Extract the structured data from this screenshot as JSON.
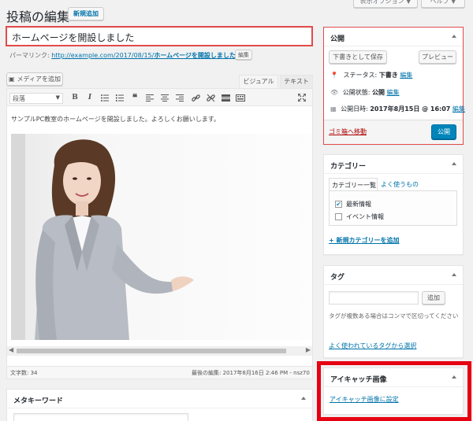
{
  "header": {
    "title": "投稿の編集",
    "add_new": "新規追加",
    "screen_options": "表示オプション ▼",
    "help": "ヘルプ ▼"
  },
  "post": {
    "title": "ホームページを開設しました",
    "permalink_label": "パーマリンク:",
    "permalink_base": "http://example.com/2017/08/15/",
    "permalink_slug": "ホームページを開設しました/",
    "permalink_edit": "編集",
    "body_text": "サンプルPC教室のホームページを開設しました。よろしくお願いします。",
    "word_count": "文字数: 34",
    "last_edited": "最後の編集: 2017年8月16日 2:46 PM - nsz70"
  },
  "editor": {
    "add_media": "メディアを追加",
    "tab_visual": "ビジュアル",
    "tab_text": "テキスト",
    "format_select": "段落"
  },
  "publish": {
    "title": "公開",
    "save_draft": "下書きとして保存",
    "preview": "プレビュー",
    "status_label": "ステータス:",
    "status_value": "下書き",
    "status_edit": "編集",
    "visibility_label": "公開状態:",
    "visibility_value": "公開",
    "visibility_edit": "編集",
    "date_label": "公開日時:",
    "date_value": "2017年8月15日 @ 16:07",
    "date_edit": "編集",
    "trash": "ゴミ箱へ移動",
    "publish_button": "公開"
  },
  "categories": {
    "title": "カテゴリー",
    "tab_all": "カテゴリー一覧",
    "tab_popular": "よく使うもの",
    "items": [
      {
        "label": "最新情報",
        "checked": true
      },
      {
        "label": "イベント情報",
        "checked": false
      }
    ],
    "add_new": "+ 新規カテゴリーを追加"
  },
  "tags": {
    "title": "タグ",
    "add_button": "追加",
    "hint": "タグが複数ある場合はコンマで区切ってください",
    "choose_popular": "よく使われているタグから選択"
  },
  "featured_image": {
    "title": "アイキャッチ画像",
    "set_link": "アイキャッチ画像に設定"
  },
  "meta_keywords": {
    "title": "メタキーワード"
  },
  "colors": {
    "highlight_red": "#e60012",
    "outline_red": "#e24b4b",
    "primary_blue": "#0085ba",
    "link_blue": "#0073aa"
  }
}
